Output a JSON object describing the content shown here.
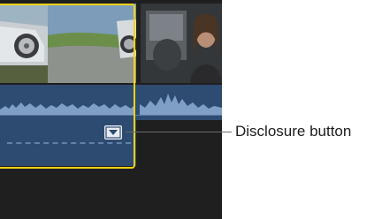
{
  "callout": {
    "label": "Disclosure button"
  },
  "timeline": {
    "clips": [
      {
        "name": "car-on-road-clip",
        "selected": true
      },
      {
        "name": "people-in-car-clip",
        "selected": false
      }
    ],
    "selection_color": "#f2d217",
    "audio_color": "#2e4c72",
    "disclosure_button_icon": "triangle-down-icon"
  }
}
